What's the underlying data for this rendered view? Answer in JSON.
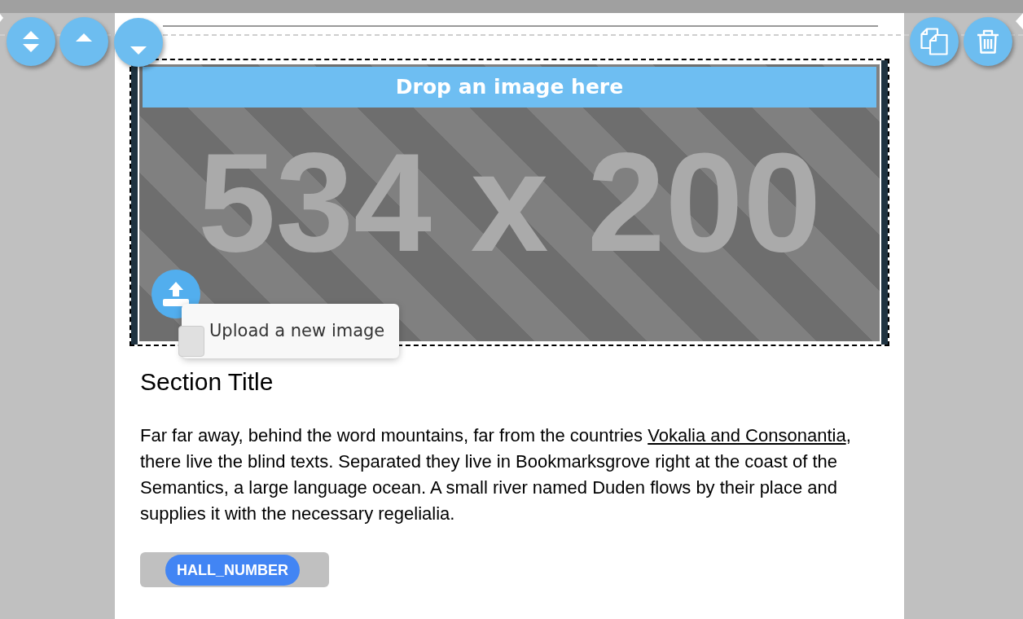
{
  "image_block": {
    "selected": true,
    "drop_label": "Drop an image here",
    "placeholder_label": "534 x 200",
    "upload_tooltip": "Upload a new image"
  },
  "section": {
    "title": "Section Title",
    "paragraph": [
      {
        "kind": "text",
        "text": "Far far away, behind the word mountains, far from the countries "
      },
      {
        "kind": "link",
        "text": "Vokalia and Consonantia"
      },
      {
        "kind": "text",
        "text": ", there live the blind texts. Separated they live in Bookmarksgrove right at the coast of the Semantics, a large language ocean. A small river named Duden flows by their place and supplies it with the necessary regelialia."
      }
    ]
  },
  "tags": [
    {
      "label": "HALL_NUMBER"
    }
  ]
}
